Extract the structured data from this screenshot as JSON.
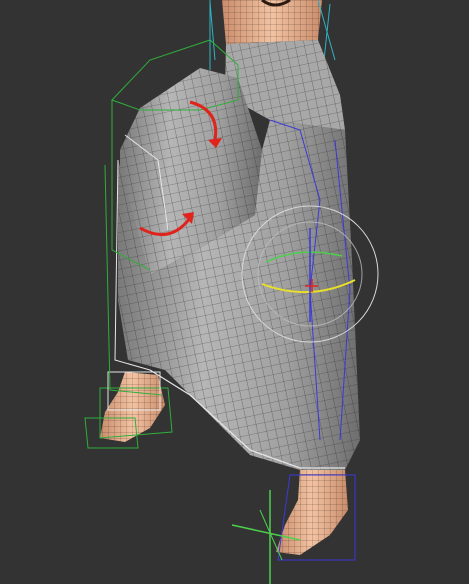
{
  "viewport": {
    "background": "#333333",
    "subject": "3d-character-robe-wireframe"
  },
  "colors": {
    "robe_fill": "#9c9c9c",
    "robe_light": "#c8c8c8",
    "skin": "#e7b18f",
    "wire": "#1e1e1e",
    "bbox_green": "#2fae3a",
    "bbox_cyan": "#2fb4c4",
    "bbox_white": "#e6e6e6",
    "bone_blue": "#3b39d8",
    "arrow_red": "#e0231d",
    "gizmo_yellow": "#e8e02a",
    "gizmo_green": "#4cd04c",
    "gizmo_white": "#d8d8d8"
  },
  "icons": {
    "rotate_arrow_upper": "rotate-arrow-icon",
    "rotate_arrow_lower": "rotate-arrow-icon",
    "transform_gizmo": "rotate-gizmo-icon",
    "pivot_axis": "pivot-axis-icon"
  }
}
